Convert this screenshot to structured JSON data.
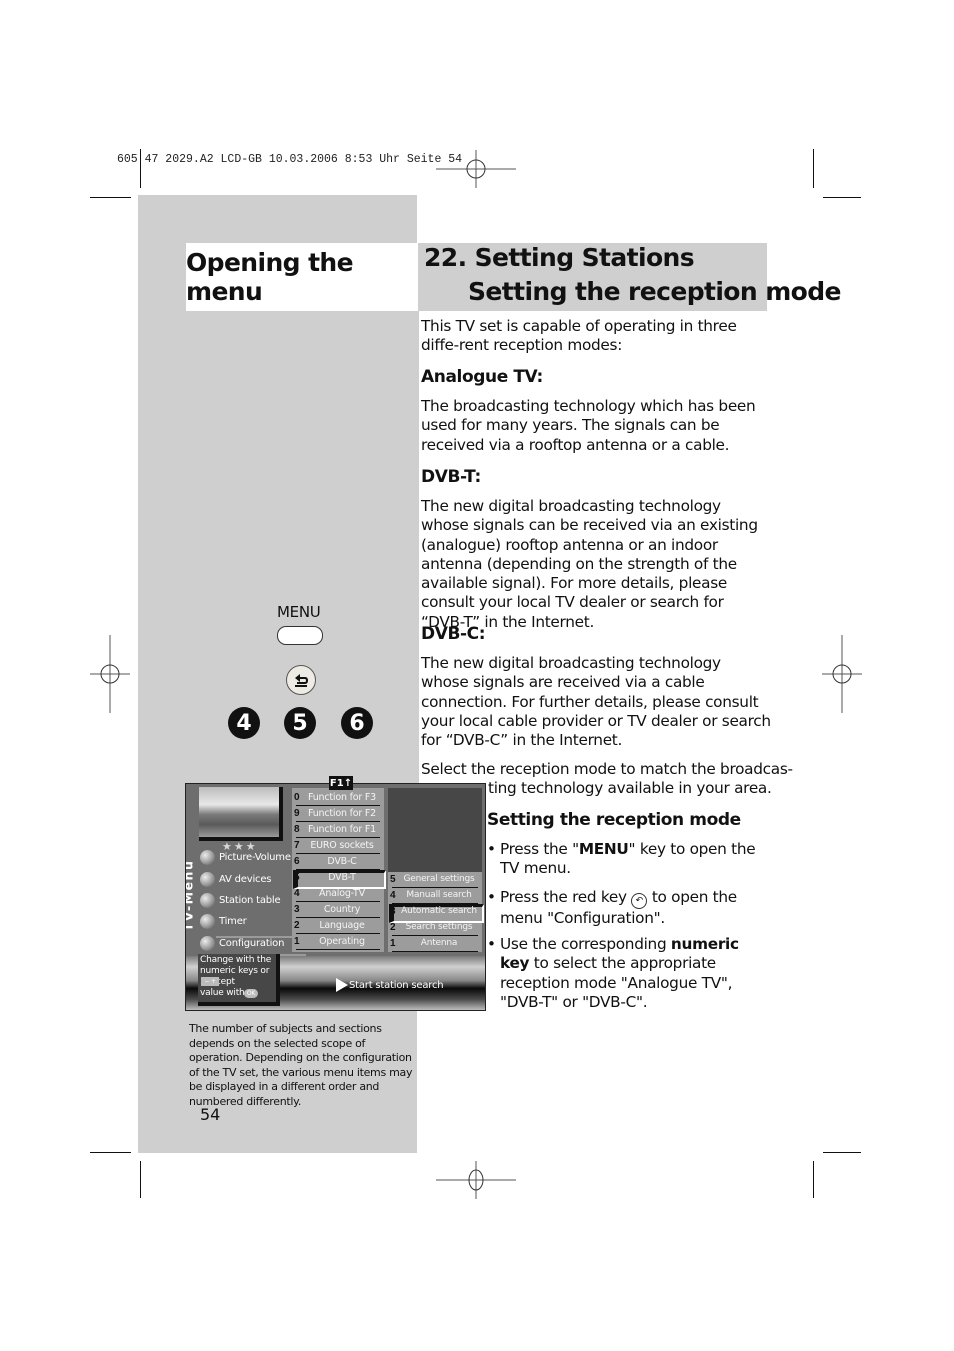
{
  "print_header": "605 47 2029.A2 LCD-GB  10.03.2006  8:53 Uhr  Seite 54",
  "left": {
    "title": "Opening the menu",
    "menu_key_label": "MENU",
    "back_key_icon": "back-arrow-icon",
    "numeric_keys": [
      "4",
      "5",
      "6"
    ],
    "footnote": "The number of subjects and sections depends on the selected scope of operation. Depending on the configuration of the TV set, the various menu items may be displayed in a different order and numbered differently.",
    "page_number": "54"
  },
  "tv_menu": {
    "vertical_title": "TV-Menu",
    "f1_badge": "F1↑",
    "stars": "★★★",
    "main_items": [
      {
        "label": "Picture-Volume"
      },
      {
        "label": "AV devices"
      },
      {
        "label": "Station table"
      },
      {
        "label": "Timer"
      },
      {
        "label": "Configuration",
        "selected": true
      }
    ],
    "config_items": [
      {
        "num": "0",
        "label": "Function for F3"
      },
      {
        "num": "9",
        "label": "Function for F2"
      },
      {
        "num": "8",
        "label": "Function for F1"
      },
      {
        "num": "7",
        "label": "EURO sockets"
      },
      {
        "num": "6",
        "label": "DVB-C"
      },
      {
        "num": "5",
        "label": "DVB-T",
        "selected": true
      },
      {
        "num": "4",
        "label": "Analog-TV"
      },
      {
        "num": "3",
        "label": "Country"
      },
      {
        "num": "2",
        "label": "Language"
      },
      {
        "num": "1",
        "label": "Operating"
      }
    ],
    "dvbt_items": [
      {
        "num": "5",
        "label": "General settings"
      },
      {
        "num": "4",
        "label": "Manuall search"
      },
      {
        "num": "3",
        "label": "Automatic search",
        "selected": true
      },
      {
        "num": "2",
        "label": "Search settings"
      },
      {
        "num": "1",
        "label": "Antenna"
      }
    ],
    "help_lines": [
      "Change with the",
      "numeric keys or",
      "      . Accept",
      "value with"
    ],
    "help_minus_plus": "− +",
    "help_ok": "OK",
    "start_label": "Start station search"
  },
  "right": {
    "title_line1": "22. Setting Stations",
    "title_line2": "Setting the reception mode",
    "intro": "This TV set is capable of operating in three diffe-rent reception modes:",
    "sections": [
      {
        "heading": "Analogue TV:",
        "text": "The broadcasting technology which has been used for many years. The signals can be received via a rooftop antenna or a cable."
      },
      {
        "heading": "DVB-T:",
        "text": "The new digital broadcasting technology whose signals can be received via an existing (analogue) rooftop antenna or an indoor antenna (depending on the strength of the available signal). For more details, please consult your local TV dealer or search for “DVB-T” in the Internet."
      },
      {
        "heading": "DVB-C:",
        "text": "The new digital broadcasting technology whose signals are received via a cable connection. For further details, please consult your local cable provider or TV dealer or search for “DVB-C” in the Internet."
      }
    ],
    "select_line1": "Select the reception mode to match the broadcas-",
    "select_line2": "ting technology available in your area.",
    "subheading": "Setting the reception mode",
    "steps": [
      {
        "pre": "Press the \"",
        "bold": "MENU",
        "post": "\" key to open the TV menu."
      },
      {
        "pre": "Press the red key ",
        "icon": "back-key-icon",
        "post": " to open the menu \"Configuration\"."
      },
      {
        "pre": "Use the corresponding ",
        "bold": "numeric key",
        "post": " to select the appropriate reception mode \"Analogue TV\", \"DVB-T\" or \"DVB-C\"."
      }
    ]
  }
}
